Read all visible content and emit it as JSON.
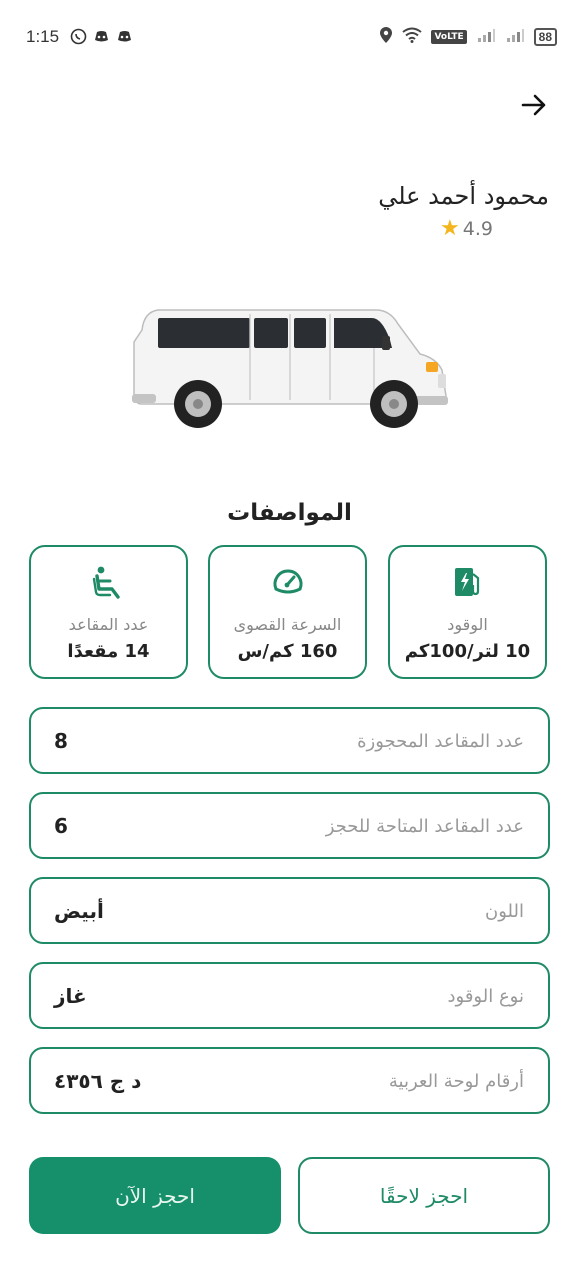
{
  "status_bar": {
    "time": "1:15",
    "left_icons": [
      "whatsapp-icon",
      "discord-icon",
      "discord-icon"
    ],
    "volte": "VoLTE",
    "battery": "88"
  },
  "header": {
    "back_icon": "arrow-right-icon"
  },
  "driver": {
    "name": "محمود أحمد علي",
    "rating": "4.9",
    "star_color": "#f3b61f"
  },
  "vehicle": {
    "image": "white-van-image"
  },
  "specs": {
    "title": "المواصفات",
    "items": [
      {
        "icon": "fuel-station-icon",
        "label": "الوقود",
        "value": "10 لتر/100كم"
      },
      {
        "icon": "speedometer-icon",
        "label": "السرعة القصوى",
        "value": "160 كم/س"
      },
      {
        "icon": "seat-icon",
        "label": "عدد المقاعد",
        "value": "14 مقعدًا"
      }
    ]
  },
  "fields": [
    {
      "label": "عدد المقاعد المحجوزة",
      "value": "8"
    },
    {
      "label": "عدد المقاعد المتاحة للحجز",
      "value": "6"
    },
    {
      "label": "اللون",
      "value": "أبيض"
    },
    {
      "label": "نوع الوقود",
      "value": "غاز"
    },
    {
      "label": "أرقام لوحة العربية",
      "value": "د ج ٤٣٥٦"
    }
  ],
  "actions": {
    "book_now": "احجز الآن",
    "book_later": "احجز لاحقًا"
  },
  "colors": {
    "accent": "#1f8a66",
    "primary_button": "#15906a"
  }
}
